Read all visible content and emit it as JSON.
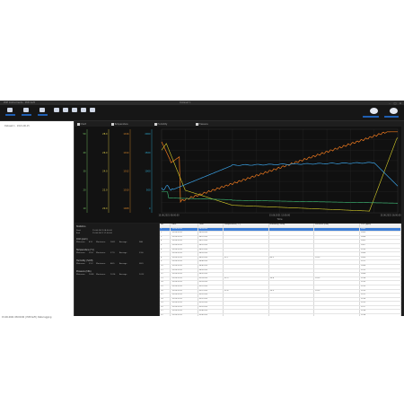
{
  "window": {
    "title": "PCE Instruments · PCE-Soft",
    "center_title": "Dataset 1"
  },
  "toolbar": {
    "buttons": [
      {
        "name": "connect",
        "icon": "plug-icon"
      },
      {
        "name": "open",
        "icon": "folder-icon"
      },
      {
        "name": "export",
        "icon": "export-icon"
      },
      {
        "name": "search",
        "icon": "search-icon"
      },
      {
        "name": "settings",
        "icon": "gear-icon"
      },
      {
        "name": "help",
        "icon": "help-icon"
      },
      {
        "name": "record",
        "icon": "record-icon"
      },
      {
        "name": "print",
        "icon": "print-icon"
      }
    ],
    "right_buttons": [
      {
        "name": "dark-mode",
        "icon": "moon-icon"
      },
      {
        "name": "light-mode",
        "icon": "sun-icon"
      }
    ]
  },
  "sidebar": {
    "tree_item": "Dataset 1 · 2021-06-15"
  },
  "tabs": [
    "Chart",
    "Temperature",
    "Humidity",
    "Pressure"
  ],
  "chart": {
    "axes": [
      {
        "color": "#7fd36b",
        "ticks": [
          "50",
          "40",
          "30",
          "20",
          "10"
        ]
      },
      {
        "color": "#e7d44a",
        "ticks": [
          "28.0",
          "26.0",
          "24.0",
          "22.0",
          "20.0"
        ]
      },
      {
        "color": "#e08a2a",
        "ticks": [
          "1016",
          "1014",
          "1012",
          "1010",
          "1008"
        ]
      },
      {
        "color": "#2fb0d8",
        "ticks": [
          "2000",
          "1500",
          "1000",
          "500",
          "0"
        ]
      }
    ],
    "x_ticks": [
      "15.06.2021 08:00:00",
      "15.06.2021 12:00:00",
      "15.06.2021 16:00:00"
    ],
    "x_title": "Time",
    "series_colors": {
      "orange": "#f07a1e",
      "yellow": "#d8cf2a",
      "blue": "#3aa2e6",
      "green": "#3fc27a"
    }
  },
  "stats": {
    "heading": "Statistics",
    "start_label": "Start",
    "start_value": "15.06.2021 08:00:00",
    "end_label": "End",
    "end_value": "15.06.2021 17:30:00",
    "groups": [
      {
        "name": "CO2 (ppm)",
        "min": "Minimum",
        "min_v": "412",
        "max": "Maximum",
        "max_v": "1821",
        "avg": "Average",
        "avg_v": "986"
      },
      {
        "name": "Temperature (°C)",
        "min": "Minimum",
        "min_v": "20.4",
        "max": "Maximum",
        "max_v": "27.9",
        "avg": "Average",
        "avg_v": "23.6"
      },
      {
        "name": "Humidity (%RH)",
        "min": "Minimum",
        "min_v": "31.2",
        "max": "Maximum",
        "max_v": "48.5",
        "avg": "Average",
        "avg_v": "38.9"
      },
      {
        "name": "Pressure (hPa)",
        "min": "Minimum",
        "min_v": "1008",
        "max": "Maximum",
        "max_v": "1016",
        "avg": "Average",
        "avg_v": "1012"
      }
    ]
  },
  "table": {
    "headers": [
      "No.",
      "Date",
      "Time",
      "Temperature [°C]",
      "Humidity [%RH]",
      "Pressure [hPa]",
      "CO2 [ppm]"
    ],
    "rows": [
      [
        "1",
        "15.06.2021",
        "08:00:00",
        "",
        "",
        "",
        "1000"
      ],
      [
        "2",
        "15.06.2021",
        "08:05:00",
        "",
        "",
        "",
        "1005"
      ],
      [
        "3",
        "15.06.2021",
        "08:10:00",
        "",
        "",
        "",
        "1008"
      ],
      [
        "4",
        "15.06.2021",
        "08:15:00",
        "",
        "",
        "",
        "1002"
      ],
      [
        "5",
        "15.06.2021",
        "08:20:00",
        "",
        "",
        "",
        "1007"
      ],
      [
        "6",
        "15.06.2021",
        "08:25:00",
        "",
        "",
        "",
        "1010"
      ],
      [
        "7",
        "15.06.2021",
        "08:30:00",
        "",
        "",
        "",
        "1006"
      ],
      [
        "8",
        "15.06.2021",
        "08:35:00",
        "22.1",
        "40.2",
        "1012",
        "1009"
      ],
      [
        "9",
        "15.06.2021",
        "08:40:00",
        "",
        "",
        "",
        "1011"
      ],
      [
        "10",
        "15.06.2021",
        "08:45:00",
        "",
        "",
        "",
        "1004"
      ],
      [
        "11",
        "15.06.2021",
        "08:50:00",
        "",
        "",
        "",
        "1012"
      ],
      [
        "12",
        "15.06.2021",
        "08:55:00",
        "",
        "",
        "",
        "1008"
      ],
      [
        "13",
        "15.06.2021",
        "09:00:00",
        "22.3",
        "39.8",
        "1012",
        "1014"
      ],
      [
        "14",
        "15.06.2021",
        "09:05:00",
        "",
        "",
        "",
        "1010"
      ],
      [
        "15",
        "15.06.2021",
        "09:10:00",
        "",
        "",
        "",
        "1013"
      ],
      [
        "16",
        "15.06.2021",
        "09:15:00",
        "22.4",
        "39.5",
        "1012",
        "1015"
      ],
      [
        "17",
        "15.06.2021",
        "09:20:00",
        "",
        "",
        "",
        "1011"
      ],
      [
        "18",
        "15.06.2021",
        "09:25:00",
        "",
        "",
        "",
        "1016"
      ],
      [
        "19",
        "15.06.2021",
        "09:30:00",
        "",
        "",
        "",
        "1012"
      ],
      [
        "20",
        "15.06.2021",
        "09:35:00",
        "",
        "",
        "",
        "1017"
      ],
      [
        "21",
        "15.06.2021",
        "09:40:00",
        "",
        "",
        "",
        "1014"
      ],
      [
        "22",
        "15.06.2021",
        "09:45:00",
        "",
        "",
        "",
        "1018"
      ],
      [
        "23",
        "15.06.2021",
        "09:50:00",
        "",
        "",
        "",
        "1015"
      ],
      [
        "24",
        "15.06.2021",
        "09:55:00",
        "",
        "",
        "",
        "1019"
      ],
      [
        "25",
        "15.06.2021",
        "10:00:00",
        "",
        "",
        "",
        "1016"
      ],
      [
        "26",
        "15.06.2021",
        "10:05:00",
        "",
        "",
        "",
        "1020"
      ],
      [
        "27",
        "15.06.2021",
        "10:10:00",
        "",
        "",
        "",
        "1018"
      ]
    ]
  },
  "status": "15.06.2021 08:00:00 | PCE-Soft | Data logging"
}
